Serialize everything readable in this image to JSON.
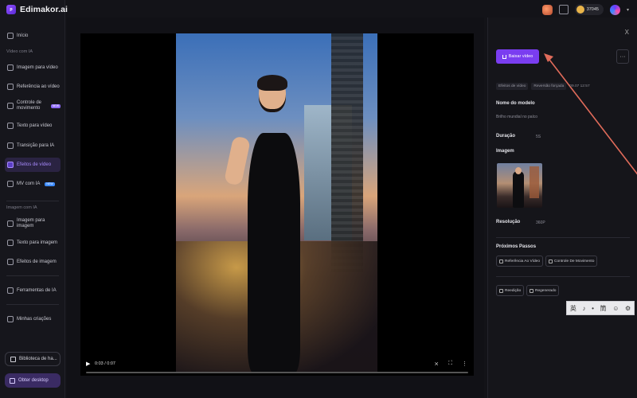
{
  "brand": {
    "name": "Edimakor.ai",
    "logo_glyph": "ᵖ"
  },
  "topbar": {
    "credits": "37045",
    "dropdown_glyph": "▾"
  },
  "sidebar": {
    "home": "Início",
    "section_video": "Vídeo com IA",
    "items_video": [
      {
        "label": "Imagem para vídeo",
        "icon": "image-icon"
      },
      {
        "label": "Referência ao vídeo",
        "icon": "reference-icon"
      },
      {
        "label": "Controle de movimento",
        "icon": "motion-icon",
        "badge": "NEW"
      },
      {
        "label": "Texto para vídeo",
        "icon": "text-icon"
      },
      {
        "label": "Transição para IA",
        "icon": "transition-icon"
      },
      {
        "label": "Efeitos de vídeo",
        "icon": "effects-icon",
        "active": true
      },
      {
        "label": "MV com IA",
        "icon": "music-icon",
        "badge": "NEW"
      }
    ],
    "section_image": "Imagem com IA",
    "items_image": [
      {
        "label": "Imagem para imagem",
        "icon": "image-icon"
      },
      {
        "label": "Texto para imagem",
        "icon": "text-icon"
      },
      {
        "label": "Efeitos de imagem",
        "icon": "effects-icon"
      }
    ],
    "tools": "Ferramentas de IA",
    "creations": "Minhas criações",
    "library_btn": "Biblioteca de ha...",
    "desktop_btn": "Obter desktop"
  },
  "player": {
    "time": "0:03 / 0:07",
    "progress": 0.0,
    "play_glyph": "▶"
  },
  "panel": {
    "close": "X",
    "download": "Baixar vídeo",
    "more": "···",
    "tags": [
      "Efeitos de vídeo",
      "Reversão forçada"
    ],
    "date": "09.07 12:57",
    "model_label": "Nome do modelo",
    "model_value": "Brilho mundial no palco",
    "duration_label": "Duração",
    "duration_value": "5S",
    "image_label": "Imagem",
    "resolution_label": "Resolução",
    "resolution_value": "360P",
    "next_label": "Próximos Passos",
    "next_actions": [
      "Referência Ao Vídeo",
      "Controle De Movimento"
    ],
    "bottom_actions": [
      "Reedição",
      "Regenerado"
    ]
  },
  "ime": [
    "英",
    "♪",
    "•",
    "筒",
    "☺",
    "⚙"
  ],
  "colors": {
    "accent": "#7a3df0",
    "arrow": "#e06b5a"
  }
}
